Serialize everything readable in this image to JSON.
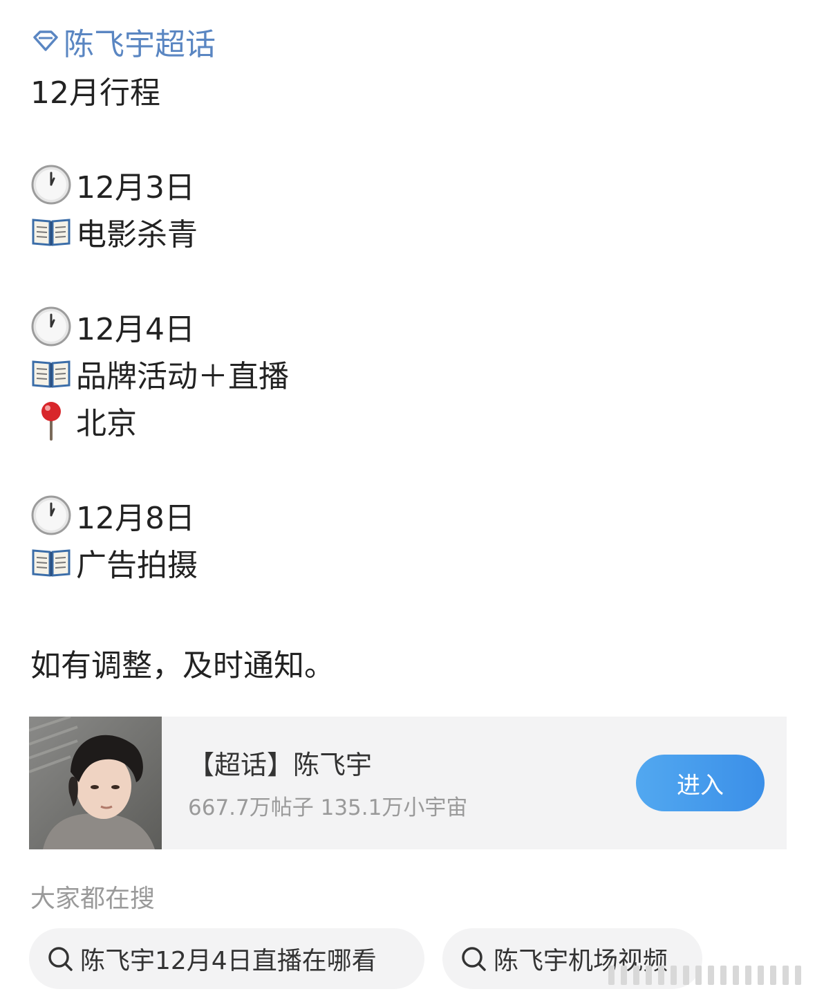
{
  "topic": {
    "icon": "diamond-icon",
    "name": "陈飞宇超话",
    "color": "#5a86c2"
  },
  "post": {
    "headline": "12月行程",
    "schedule": [
      {
        "date_icon": "clock-icon",
        "date": "12月3日",
        "event_icon": "book-icon",
        "event": "电影杀青"
      },
      {
        "date_icon": "clock-icon",
        "date": "12月4日",
        "event_icon": "book-icon",
        "event": "品牌活动＋直播",
        "location_icon": "pin-icon",
        "location": "北京"
      },
      {
        "date_icon": "clock-icon",
        "date": "12月8日",
        "event_icon": "book-icon",
        "event": "广告拍摄"
      }
    ],
    "closing": "如有调整，及时通知。"
  },
  "supertopic_card": {
    "title": "【超话】陈飞宇",
    "stats": "667.7万帖子 135.1万小宇宙",
    "enter_label": "进入",
    "button_color": "#3b8fe8",
    "thumbnail": "avatar-photo"
  },
  "search": {
    "heading": "大家都在搜",
    "suggestions": [
      {
        "icon": "search-icon",
        "text": "陈飞宇12月4日直播在哪看"
      },
      {
        "icon": "search-icon",
        "text": "陈飞宇机场视频"
      }
    ]
  }
}
